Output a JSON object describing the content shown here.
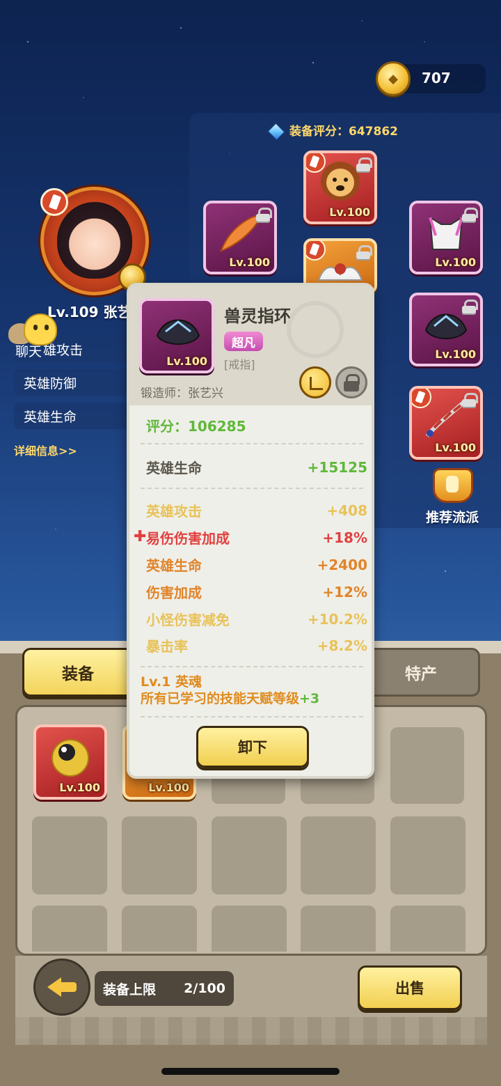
{
  "currency": {
    "icon": "gold-coin-icon",
    "value": "707"
  },
  "equipment_score": {
    "icon": "gem-icon",
    "label": "装备评分：647862"
  },
  "hero": {
    "name": "Lv.109 张艺",
    "portrait": "hero-portrait"
  },
  "chat": {
    "label": "聊天"
  },
  "attributes": [
    {
      "label": "雄攻击"
    },
    {
      "label": "英雄防御"
    },
    {
      "label": "英雄生命"
    }
  ],
  "detail_link": "详细信息>>",
  "equipped_slots": [
    {
      "icon": "feather-icon",
      "level": "Lv.100",
      "rarity": "purple"
    },
    {
      "icon": "lion-mask-icon",
      "level": "Lv.100",
      "rarity": "red"
    },
    {
      "icon": "wing-armor-icon",
      "level": "Lv.100",
      "rarity": "orange"
    },
    {
      "icon": "pink-armor-icon",
      "level": "Lv.100",
      "rarity": "purple"
    },
    {
      "icon": "beast-ring-icon",
      "level": "Lv.100",
      "rarity": "purple"
    },
    {
      "icon": "spiked-whip-icon",
      "level": "Lv.100",
      "rarity": "red"
    }
  ],
  "recommend": {
    "label": "推荐流派",
    "icon": "thumbs-up-icon"
  },
  "tabs": [
    {
      "label": "装备",
      "active": true
    },
    {
      "label": "特产",
      "active": false
    }
  ],
  "inventory": [
    {
      "icon": "eyeball-icon",
      "level": "Lv.100",
      "rarity": "red"
    },
    {
      "icon": "item-icon",
      "level": "Lv.100",
      "rarity": "orange"
    }
  ],
  "footer": {
    "capacity_label": "装备上限",
    "capacity_value": "2/100",
    "sell_label": "出售"
  },
  "popup": {
    "title": "兽灵指环",
    "level": "Lv.100",
    "rarity": "超凡",
    "type": "[戒指]",
    "forger": "锻造师：张艺兴",
    "score": "评分：106285",
    "main_stat": {
      "name": "英雄生命",
      "value": "+15125"
    },
    "sub_stats": [
      {
        "name": "英雄攻击",
        "value": "+408",
        "color": "#e8c25a"
      },
      {
        "name": "易伤伤害加成",
        "value": "+18%",
        "color": "#e04040",
        "mark": "✚"
      },
      {
        "name": "英雄生命",
        "value": "+2400",
        "color": "#e0842a"
      },
      {
        "name": "伤害加成",
        "value": "+12%",
        "color": "#e0842a"
      },
      {
        "name": "小怪伤害减免",
        "value": "+10.2%",
        "color": "#e8c25a"
      },
      {
        "name": "暴击率",
        "value": "+8.2%",
        "color": "#e8c25a"
      }
    ],
    "soul_line1": "Lv.1 英魂",
    "soul_line2": "所有已学习的技能天赋等级",
    "soul_plus": "+3",
    "unequip_label": "卸下"
  }
}
